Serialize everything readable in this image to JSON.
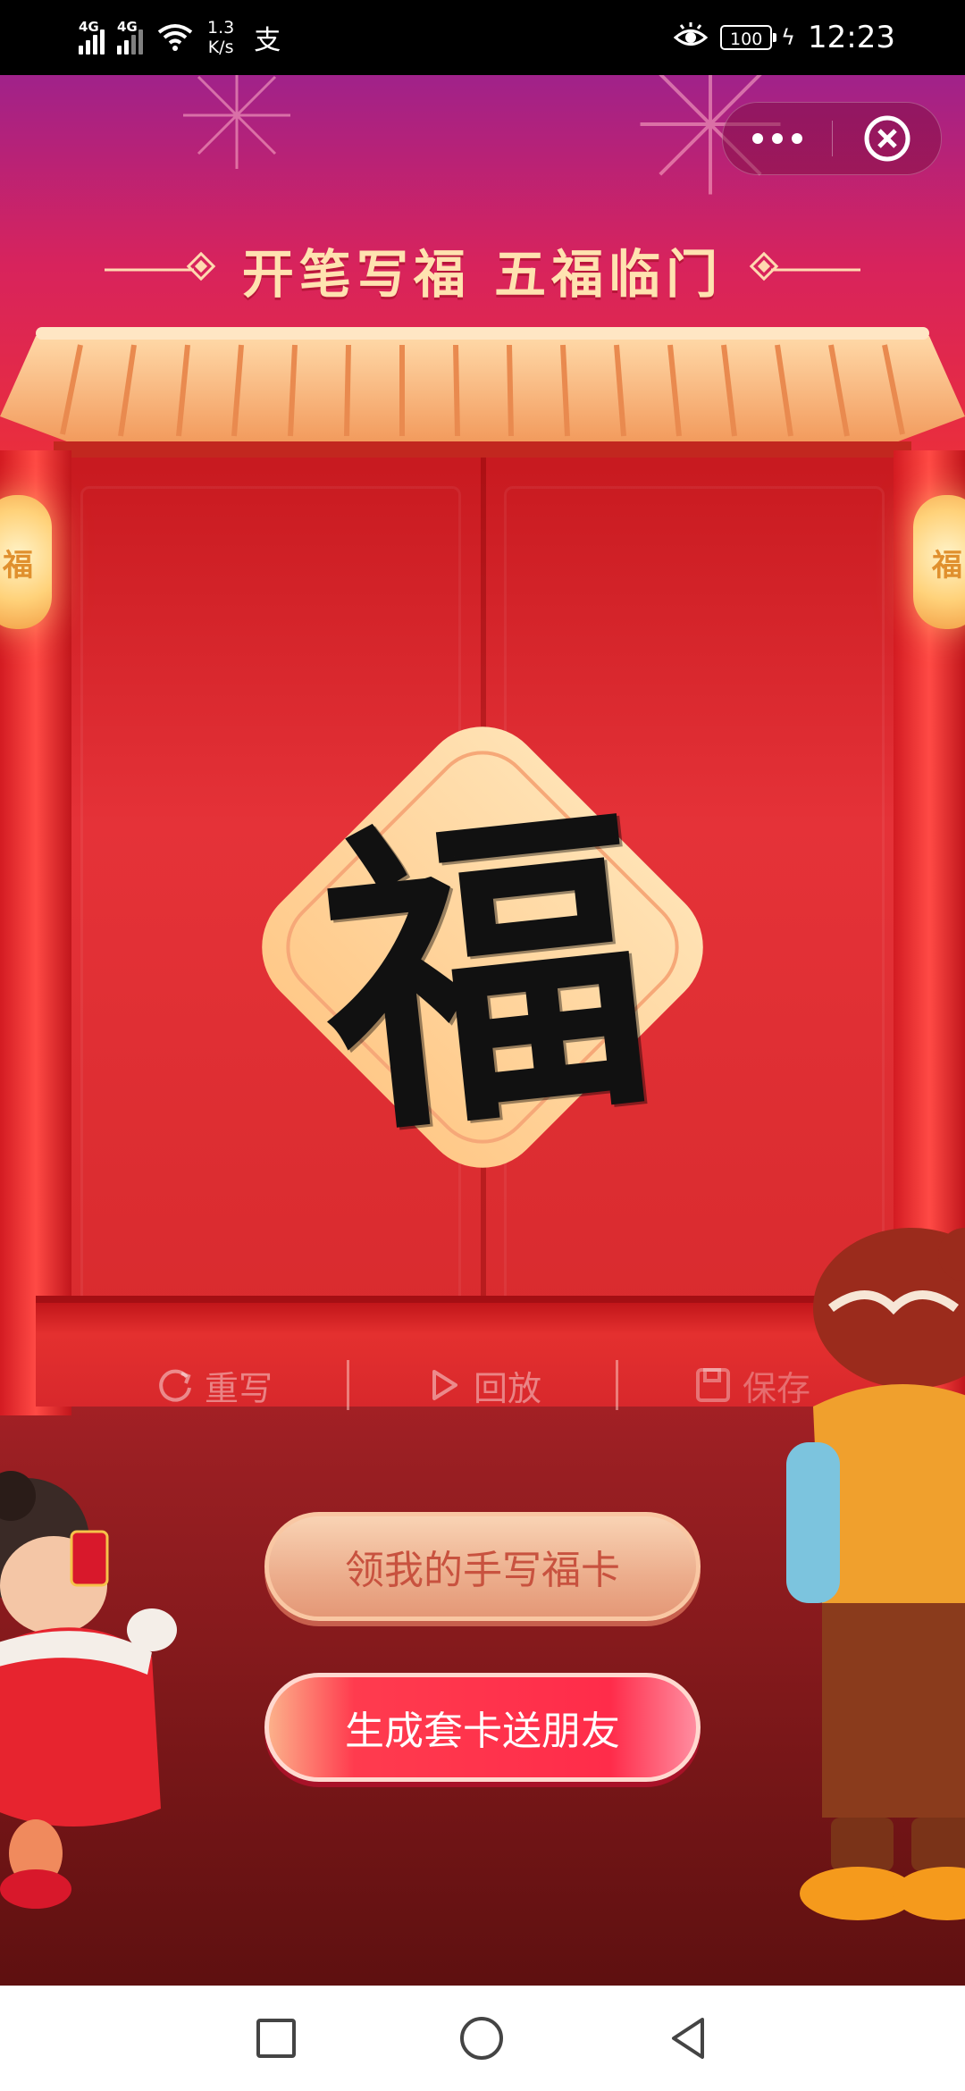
{
  "status_bar": {
    "net1": "4G",
    "net2": "4G",
    "speed_value": "1.3",
    "speed_unit": "K/s",
    "app_icon": "支",
    "battery": "100",
    "time": "12:23"
  },
  "header": {
    "title": "开笔写福  五福临门"
  },
  "canvas": {
    "character": "福",
    "lantern_char": "福"
  },
  "toolbar": {
    "rewrite_label": "重写",
    "replay_label": "回放",
    "save_label": "保存"
  },
  "actions": {
    "get_card_label": "领我的手写福卡",
    "share_label": "生成套卡送朋友"
  },
  "colors": {
    "accent": "#ff2c4a",
    "title": "#ffe2b0",
    "diamond": "#ffd79c"
  },
  "icons": {
    "more": "more-dots-icon",
    "close": "close-circle-icon",
    "rewrite": "refresh-icon",
    "replay": "play-icon",
    "save": "save-icon",
    "nav_recent": "square-icon",
    "nav_home": "circle-icon",
    "nav_back": "triangle-back-icon"
  }
}
